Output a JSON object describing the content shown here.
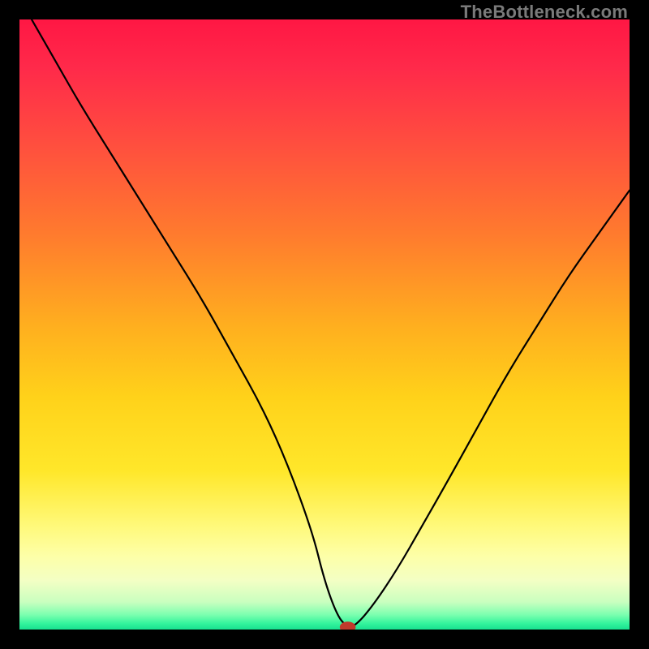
{
  "watermark": "TheBottleneck.com",
  "gradient": {
    "stops": [
      {
        "offset": 0.0,
        "color": "#ff1744"
      },
      {
        "offset": 0.08,
        "color": "#ff2a4a"
      },
      {
        "offset": 0.2,
        "color": "#ff4d3f"
      },
      {
        "offset": 0.35,
        "color": "#ff7a2e"
      },
      {
        "offset": 0.5,
        "color": "#ffae1f"
      },
      {
        "offset": 0.62,
        "color": "#ffd21a"
      },
      {
        "offset": 0.74,
        "color": "#ffe72a"
      },
      {
        "offset": 0.83,
        "color": "#fff97a"
      },
      {
        "offset": 0.88,
        "color": "#fdffa8"
      },
      {
        "offset": 0.92,
        "color": "#f3ffc4"
      },
      {
        "offset": 0.955,
        "color": "#c9ffbf"
      },
      {
        "offset": 0.975,
        "color": "#7fffb0"
      },
      {
        "offset": 0.99,
        "color": "#34f49d"
      },
      {
        "offset": 1.0,
        "color": "#18e08f"
      }
    ]
  },
  "chart_data": {
    "type": "line",
    "title": "",
    "xlabel": "",
    "ylabel": "",
    "xlim": [
      0,
      100
    ],
    "ylim": [
      0,
      100
    ],
    "grid": false,
    "legend": false,
    "series": [
      {
        "name": "bottleneck-curve",
        "x": [
          2,
          6,
          10,
          15,
          20,
          25,
          30,
          35,
          40,
          44,
          48,
          50,
          52,
          53.5,
          55,
          58,
          62,
          66,
          70,
          75,
          80,
          85,
          90,
          95,
          100
        ],
        "y": [
          100,
          93,
          86,
          78,
          70,
          62,
          54,
          45,
          36,
          27,
          16,
          8,
          2.5,
          0.5,
          0.5,
          4,
          10,
          17,
          24,
          33,
          42,
          50,
          58,
          65,
          72
        ]
      }
    ],
    "marker": {
      "x": 53.8,
      "y": 0.4,
      "rx": 1.3,
      "ry": 0.9,
      "color": "#c0392b"
    }
  }
}
